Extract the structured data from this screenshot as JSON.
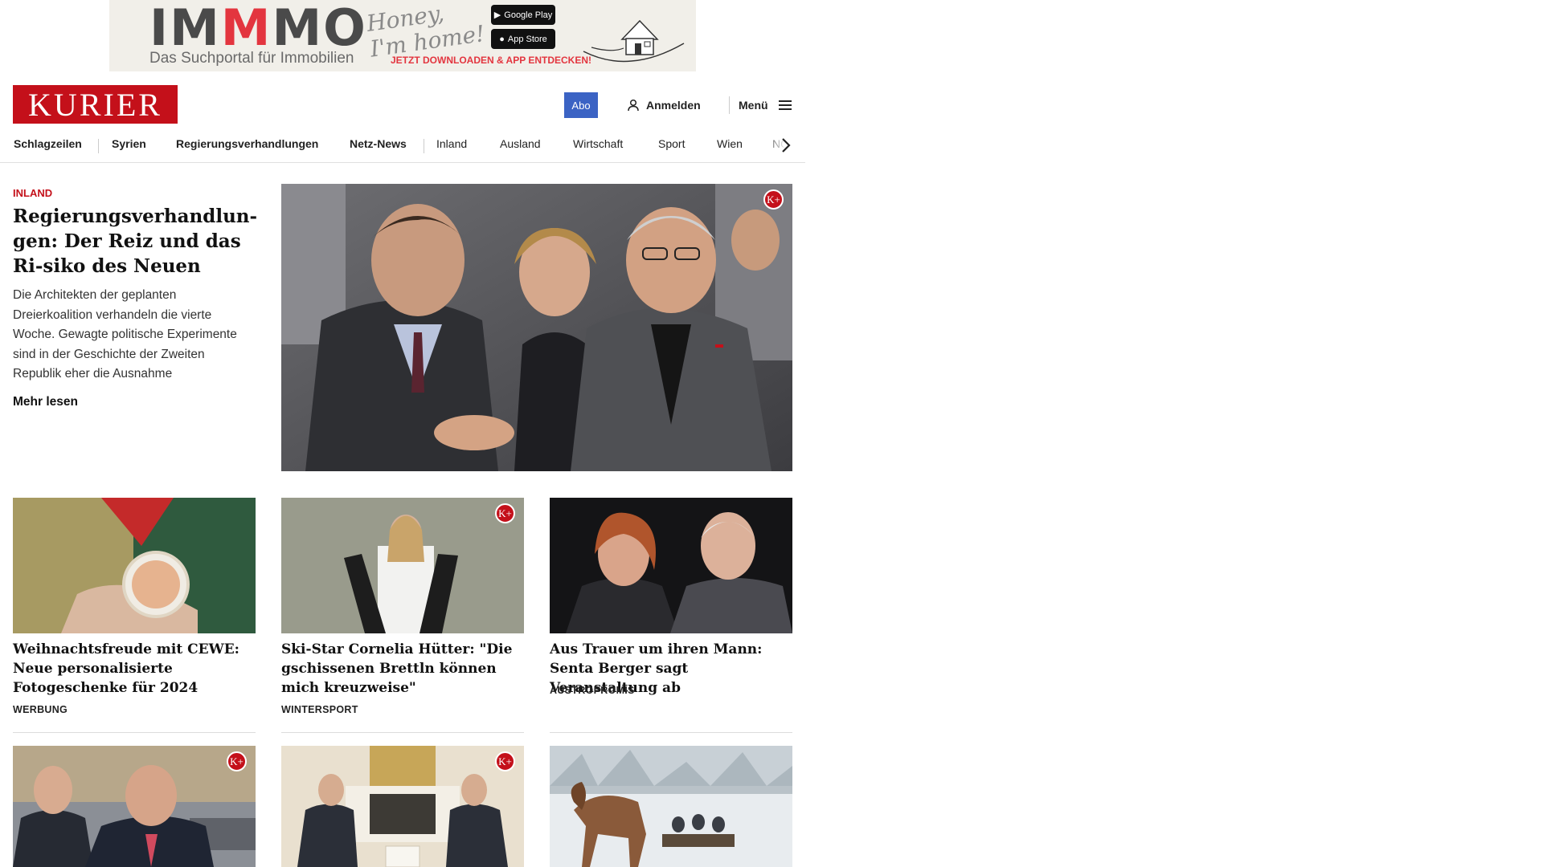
{
  "ad": {
    "brand_pre": "IM",
    "brand_m": "M",
    "brand_post": "MO",
    "subline": "Das Suchportal für Immobilien",
    "script_line1": "Honey,",
    "script_line2": "I'm home!",
    "google_play": "Google Play",
    "app_store": "App Store",
    "cta": "JETZT DOWNLOADEN & APP ENTDECKEN!"
  },
  "header": {
    "logo": "KURIER",
    "abo": "Abo",
    "login": "Anmelden",
    "menu": "Menü"
  },
  "nav": {
    "items": [
      "Schlagzeilen",
      "Syrien",
      "Regierungsverhandlungen",
      "Netz-News",
      "Inland",
      "Ausland",
      "Wirtschaft",
      "Sport",
      "Wien",
      "NÖ"
    ]
  },
  "hero": {
    "kicker": "INLAND",
    "title": "Regierungsverhandlun-gen: Der Reiz und das Ri-siko des Neuen",
    "teaser": "Die Architekten der geplanten Dreierkoalition verhandeln die vierte Woche. Gewagte politische Experimente sind in der Geschichte der Zweiten Republik eher die Ausnahme",
    "more": "Mehr lesen",
    "premium_badge": "K+"
  },
  "cards": [
    {
      "title": "Weihnachtsfreude mit CEWE: Neue personalisierte Fotogeschenke für 2024",
      "category": "WERBUNG",
      "premium": false
    },
    {
      "title": "Ski-Star Cornelia Hütter: \"Die gschissenen Brettln können mich kreuzweise\"",
      "category": "WINTERSPORT",
      "premium": true
    },
    {
      "title": "Aus Trauer um ihren Mann: Senta Berger sagt Veranstaltung ab",
      "category": "AUSTROPROMIS",
      "premium": false
    }
  ],
  "bottom_cards": [
    {
      "premium": true
    },
    {
      "premium": true
    },
    {
      "premium": false
    }
  ],
  "premium_label": "K+",
  "colors": {
    "brand_red": "#c4101a",
    "abo_blue": "#3b63c4"
  },
  "icons": {
    "login": "user-icon",
    "menu": "hamburger-icon",
    "nav_next": "chevron-right-icon"
  }
}
